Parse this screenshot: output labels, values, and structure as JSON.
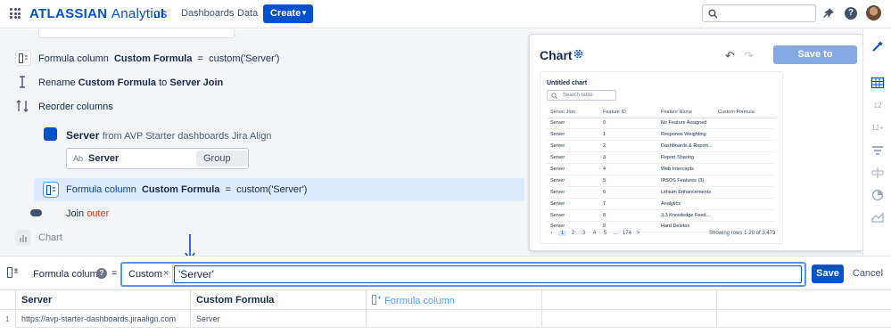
{
  "topnav": {
    "brand_bold": "ATLASSIAN",
    "brand_light": "Analytics",
    "links": [
      "Dashboards",
      "Data"
    ],
    "create_label": "Create",
    "search_placeholder": ""
  },
  "steps": {
    "formula1": {
      "prefix": "Formula column",
      "name": "Custom Formula",
      "eq": "=",
      "expr": "custom('Server')"
    },
    "rename": {
      "prefix": "Rename",
      "from": "Custom Formula",
      "to_word": "to",
      "to": "Server Join"
    },
    "reorder": {
      "label": "Reorder columns"
    },
    "source": {
      "name": "Server",
      "from_text": "from AVP Starter dashboards Jira Align",
      "col_type": "Ab",
      "col_name": "Server",
      "group_label": "Group"
    },
    "formula2": {
      "prefix": "Formula column",
      "name": "Custom Formula",
      "eq": "=",
      "expr": "custom('Server')"
    },
    "join": {
      "label": "Join",
      "type": "outer"
    },
    "chart": {
      "label": "Chart"
    }
  },
  "chart_panel": {
    "title": "Chart",
    "save_label": "Save to dashboard",
    "inner_title": "Untitled chart",
    "search_placeholder": "Search table",
    "headers": [
      "Server Join",
      "Feature ID",
      "Feature Name",
      "Custom Formula"
    ],
    "rows": [
      [
        "Server",
        "0",
        "No Feature Assigned",
        ""
      ],
      [
        "Server",
        "1",
        "Response Weighting",
        ""
      ],
      [
        "Server",
        "2",
        "Dashboards & Report...",
        ""
      ],
      [
        "Server",
        "3",
        "Report Sharing",
        ""
      ],
      [
        "Server",
        "4",
        "Web Intercepts",
        ""
      ],
      [
        "Server",
        "5",
        "IPSOS Features (3)",
        ""
      ],
      [
        "Server",
        "6",
        "Lithium Enhancements",
        ""
      ],
      [
        "Server",
        "7",
        "Analytics",
        ""
      ],
      [
        "Server",
        "8",
        "3.3 Knowledge Feed...",
        ""
      ],
      [
        "Server",
        "9",
        "Hard Deletes",
        ""
      ]
    ],
    "pages": [
      "1",
      "2",
      "3",
      "4",
      "5",
      "...",
      "174",
      ">"
    ],
    "showing": "Showing rows 1-20 of 3,473"
  },
  "sidebar": {
    "num1": "12",
    "num2": "12+"
  },
  "editor": {
    "label": "Formula column",
    "help": "?",
    "eq": "=",
    "chip_label": "Custom",
    "chip_close": "×",
    "formula_value": "'Server'",
    "save_label": "Save",
    "cancel_label": "Cancel"
  },
  "datatable": {
    "headers": [
      "Server",
      "Custom Formula",
      "Formula column"
    ],
    "row_number": "1",
    "row": [
      "https://avp-starter-dashboards.jiraalign.com",
      "Server"
    ]
  },
  "colors": {
    "primary": "#0052cc",
    "accent_light": "#deebff",
    "outer_join": "#de350b"
  }
}
